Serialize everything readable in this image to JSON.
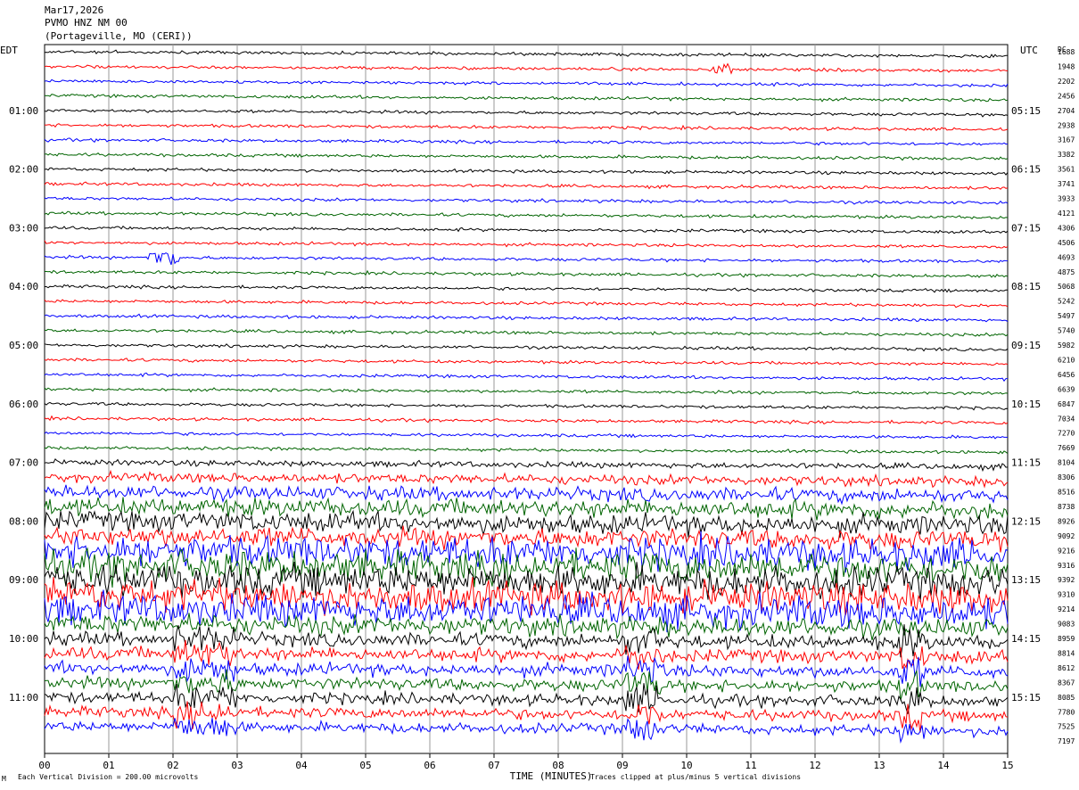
{
  "header": {
    "date": "Mar17,2026",
    "station": "PVMO HNZ NM 00",
    "location": "(Portageville, MO (CERI))"
  },
  "colors": {
    "black": "#000000",
    "red": "#ff0000",
    "blue": "#0000ff",
    "green": "#006400",
    "grid": "#9a9a9a"
  },
  "chart_data": {
    "type": "line",
    "title": "PVMO HNZ NM 00",
    "xlabel": "TIME (MINUTES)",
    "x_ticks": [
      "00",
      "01",
      "02",
      "03",
      "04",
      "05",
      "06",
      "07",
      "08",
      "09",
      "10",
      "11",
      "12",
      "13",
      "14",
      "15"
    ],
    "xlim": [
      0,
      15
    ],
    "left_axis_title": "EDT",
    "right_axis_title": "UTC",
    "dc_title": "DC",
    "left_hour_labels": [
      "01:00",
      "02:00",
      "03:00",
      "04:00",
      "05:00",
      "06:00",
      "07:00",
      "08:00",
      "09:00",
      "10:00",
      "11:00"
    ],
    "right_hour_labels": [
      "05:15",
      "06:15",
      "07:15",
      "08:15",
      "09:15",
      "10:15",
      "11:15",
      "12:15",
      "13:15",
      "14:15",
      "15:15"
    ],
    "trace_count": 47,
    "trace_color_cycle": [
      "black",
      "red",
      "blue",
      "green"
    ],
    "dc_offsets": [
      "1688",
      "1948",
      "2202",
      "2456",
      "2704",
      "2938",
      "3167",
      "3382",
      "3561",
      "3741",
      "3933",
      "4121",
      "4306",
      "4506",
      "4693",
      "4875",
      "5068",
      "5242",
      "5497",
      "5740",
      "5982",
      "6210",
      "6456",
      "6639",
      "6847",
      "7034",
      "7270",
      "7669",
      "8104",
      "8306",
      "8516",
      "8738",
      "8926",
      "9092",
      "9216",
      "9316",
      "9392",
      "9310",
      "9214",
      "9083",
      "8959",
      "8814",
      "8612",
      "8367",
      "8085",
      "7780",
      "7525",
      "7197"
    ],
    "footer_left": "Each Vertical Division =  200.00 microvolts",
    "footer_right": "Traces clipped at plus/minus 5 vertical divisions",
    "corner_mark": "M"
  }
}
